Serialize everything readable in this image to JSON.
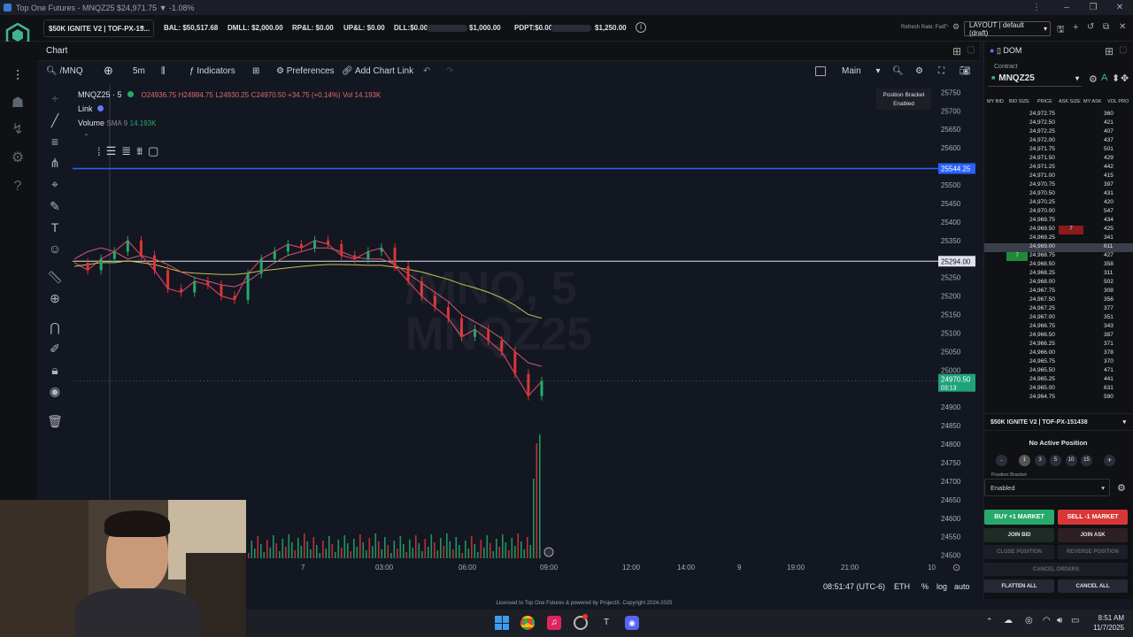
{
  "window": {
    "title": "Top One Futures - MNQZ25 $24,971.75 ▼ -1.08%"
  },
  "topbar": {
    "account": "$50K IGNITE V2 | TOF-PX-15...",
    "bal": "BAL: $50,517.68",
    "dmll": "DMLL: $2,000.00",
    "rpl": "RP&L: $0.00",
    "upl": "UP&L: $0.00",
    "dll_label": "DLL:$0.00",
    "dll_max": "$1,000.00",
    "pdpt_label": "PDPT:$0.00",
    "pdpt_max": "$1,250.00",
    "refresh": "Refresh Rate: Fast",
    "layout": "LAYOUT | default (draft)"
  },
  "chart": {
    "tab_label": "Chart",
    "symbol_search": "/MNQ",
    "interval": "5m",
    "indicators_label": "Indicators",
    "preferences_label": "Preferences",
    "add_chart_link_label": "Add Chart Link",
    "main_label": "Main",
    "legend_symbol": "MNQZ25 · 5",
    "ohlc": {
      "o": "O24936.75",
      "h": "H24984.75",
      "l": "L24930.25",
      "c": "C24970.50 +34.75 (+0.14%)",
      "vol": "Vol 14.193K"
    },
    "link_label": "Link",
    "volume_label": "Volume",
    "volume_sma": "SMA 9",
    "volume_value": "14.193K",
    "watermark_1": "/MNQ, 5",
    "watermark_2": "MNQZ25",
    "position_bracket": "Position Bracket",
    "position_bracket_state": "Enabled",
    "price_tag_blue": "25544.25",
    "price_tag_white": "25294.00",
    "price_tag_last": "24970.50",
    "price_tag_countdown": "03:13",
    "clock": "08:51:47 (UTC-6)",
    "session": "ETH",
    "scale_pct": "%",
    "scale_log": "log",
    "scale_auto": "auto",
    "footer": "Licensed to Top One Futures & powered by ProjectX. Copyright 2024-2025"
  },
  "chart_data": {
    "type": "line",
    "title": "MNQZ25 · 5",
    "xlabel": "",
    "ylabel": "",
    "x_ticks": [
      "7",
      "03:00",
      "06:00",
      "09:00",
      "12:00",
      "14:00",
      "9",
      "19:00",
      "21:00",
      "10"
    ],
    "y_ticks": [
      25750,
      25700,
      25650,
      25600,
      25550,
      25500,
      25450,
      25400,
      25350,
      25300,
      25250,
      25200,
      25150,
      25100,
      25050,
      25000,
      24950,
      24900,
      24850,
      24800,
      24750,
      24700,
      24650,
      24600,
      24550,
      24500
    ],
    "ylim": [
      24480,
      25770
    ],
    "horizontal_lines": [
      25544.25,
      25294.0
    ],
    "last_price": 24970.5,
    "series": [
      {
        "values": [
          25290,
          25270,
          25300,
          25320,
          25350,
          25310,
          25270,
          25220,
          25210,
          25240,
          25230,
          25200,
          25190,
          25260,
          25300,
          25320,
          25340,
          25330,
          25350,
          25340,
          25310,
          25300,
          25320,
          25330,
          25280,
          25240,
          25200,
          25170,
          25140,
          25090,
          25110,
          25080,
          25050,
          24990,
          24930,
          24970
        ]
      },
      {
        "values": [
          25280,
          25285,
          25290,
          25290,
          25295,
          25290,
          25285,
          25275,
          25265,
          25262,
          25260,
          25258,
          25258,
          25262,
          25268,
          25272,
          25276,
          25280,
          25283,
          25285,
          25285,
          25284,
          25283,
          25283,
          25278,
          25272,
          25265,
          25255,
          25245,
          25232,
          25222,
          25210,
          25195,
          25175,
          25150,
          25140
        ]
      },
      {
        "values": [
          25300,
          25320,
          25330,
          25320,
          25300,
          25310,
          25300,
          25285,
          25265,
          25250,
          25240,
          25230,
          25225,
          25240,
          25265,
          25290,
          25310,
          25320,
          25330,
          25330,
          25320,
          25305,
          25300,
          25300,
          25285,
          25260,
          25235,
          25210,
          25185,
          25150,
          25130,
          25110,
          25085,
          25050,
          25020,
          25010
        ]
      }
    ]
  },
  "dom": {
    "title": "DOM",
    "contract_label": "Contract",
    "contract": "MNQZ25",
    "headers": [
      "MY BID",
      "BID SIZE",
      "PRICE",
      "ASK SIZE",
      "MY ASK",
      "VOL PRO"
    ],
    "rows": [
      {
        "price": "24,972.75",
        "vol": "360"
      },
      {
        "price": "24,972.50",
        "vol": "421"
      },
      {
        "price": "24,972.25",
        "vol": "407"
      },
      {
        "price": "24,972.00",
        "vol": "437"
      },
      {
        "price": "24,971.75",
        "vol": "501"
      },
      {
        "price": "24,971.50",
        "vol": "429"
      },
      {
        "price": "24,971.25",
        "vol": "442"
      },
      {
        "price": "24,971.00",
        "vol": "415"
      },
      {
        "price": "24,970.75",
        "vol": "397"
      },
      {
        "price": "24,970.50",
        "vol": "431"
      },
      {
        "price": "24,970.25",
        "vol": "420"
      },
      {
        "price": "24,970.00",
        "vol": "547"
      },
      {
        "price": "24,969.75",
        "vol": "434"
      },
      {
        "price": "24,969.50",
        "vol": "425",
        "ask": "7"
      },
      {
        "price": "24,969.25",
        "vol": "341"
      },
      {
        "price": "24,969.00",
        "vol": "611"
      },
      {
        "price": "24,968.75",
        "vol": "427",
        "bid": "7"
      },
      {
        "price": "24,968.50",
        "vol": "358"
      },
      {
        "price": "24,968.25",
        "vol": "311"
      },
      {
        "price": "24,968.00",
        "vol": "502"
      },
      {
        "price": "24,967.75",
        "vol": "308"
      },
      {
        "price": "24,967.50",
        "vol": "356"
      },
      {
        "price": "24,967.25",
        "vol": "377"
      },
      {
        "price": "24,967.00",
        "vol": "351"
      },
      {
        "price": "24,966.75",
        "vol": "343"
      },
      {
        "price": "24,966.50",
        "vol": "387"
      },
      {
        "price": "24,966.25",
        "vol": "371"
      },
      {
        "price": "24,966.00",
        "vol": "378"
      },
      {
        "price": "24,965.75",
        "vol": "370"
      },
      {
        "price": "24,965.50",
        "vol": "471"
      },
      {
        "price": "24,965.25",
        "vol": "441"
      },
      {
        "price": "24,965.00",
        "vol": "631"
      },
      {
        "price": "24,964.75",
        "vol": "590"
      }
    ],
    "account_select": "$50K IGNITE V2 | TOF-PX-151438",
    "no_position": "No Active Position",
    "qty_options": [
      "1",
      "3",
      "5",
      "10",
      "15"
    ],
    "bracket_label": "Position Bracket",
    "bracket_value": "Enabled",
    "buy_market": "BUY +1 MARKET",
    "sell_market": "SELL -1 MARKET",
    "join_bid": "JOIN BID",
    "join_ask": "JOIN ASK",
    "close_position": "CLOSE POSITION",
    "reverse_position": "REVERSE POSITION",
    "cancel_orders": "CANCEL ORDERS",
    "flatten_all": "FLATTEN ALL",
    "cancel_all": "CANCEL ALL"
  },
  "taskbar": {
    "time": "8:51 AM",
    "date": "11/7/2025"
  },
  "colors": {
    "buy": "#26a96a",
    "sell": "#d93636",
    "accent_blue": "#2962ff",
    "last_price": "#1fa37a"
  }
}
